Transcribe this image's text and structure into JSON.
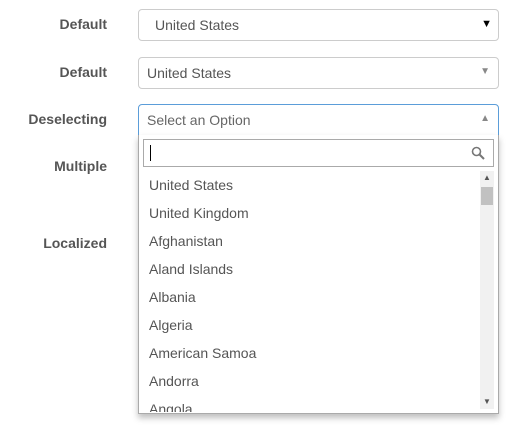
{
  "fields": [
    {
      "label": "Default",
      "value": "United States"
    },
    {
      "label": "Default",
      "value": "United States"
    },
    {
      "label": "Deselecting",
      "placeholder": "Select an Option"
    },
    {
      "label": "Multiple"
    },
    {
      "label": "Localized"
    }
  ],
  "icons": {
    "arrow_solid": "▼",
    "arrow_down": "▼",
    "arrow_up": "▲",
    "search": "search-icon",
    "scroll_up": "▲",
    "scroll_down": "▼"
  },
  "dropdown": {
    "search_value": "",
    "options": [
      "United States",
      "United Kingdom",
      "Afghanistan",
      "Aland Islands",
      "Albania",
      "Algeria",
      "American Samoa",
      "Andorra",
      "Angola"
    ]
  },
  "colors": {
    "focus_border": "#5b9dd9",
    "border": "#cccccc",
    "label": "#555555"
  }
}
